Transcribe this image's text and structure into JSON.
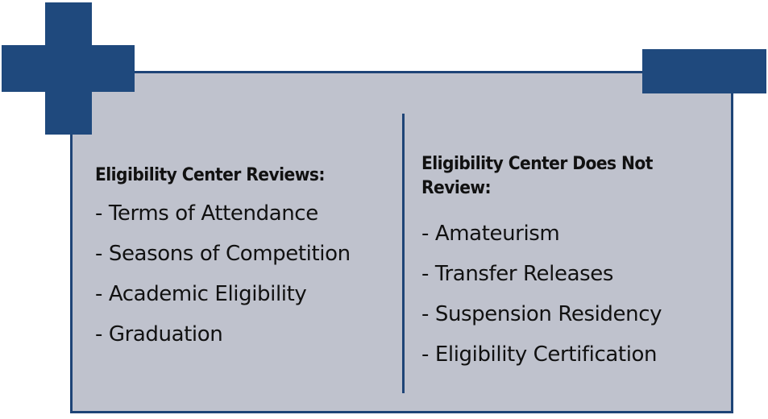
{
  "left_column": {
    "heading": "Eligibility Center Reviews:",
    "items": [
      "- Terms of Attendance",
      "- Seasons of Competition",
      "- Academic Eligibility",
      "- Graduation"
    ]
  },
  "right_column": {
    "heading_line1": "Eligibility Center Does Not",
    "heading_line2": "Review:",
    "items": [
      "- Amateurism",
      "- Transfer Releases",
      "- Suspension Residency",
      "- Eligibility Certification"
    ]
  },
  "colors": {
    "accent": "#1f497d",
    "panel": "#bfc2cd"
  }
}
